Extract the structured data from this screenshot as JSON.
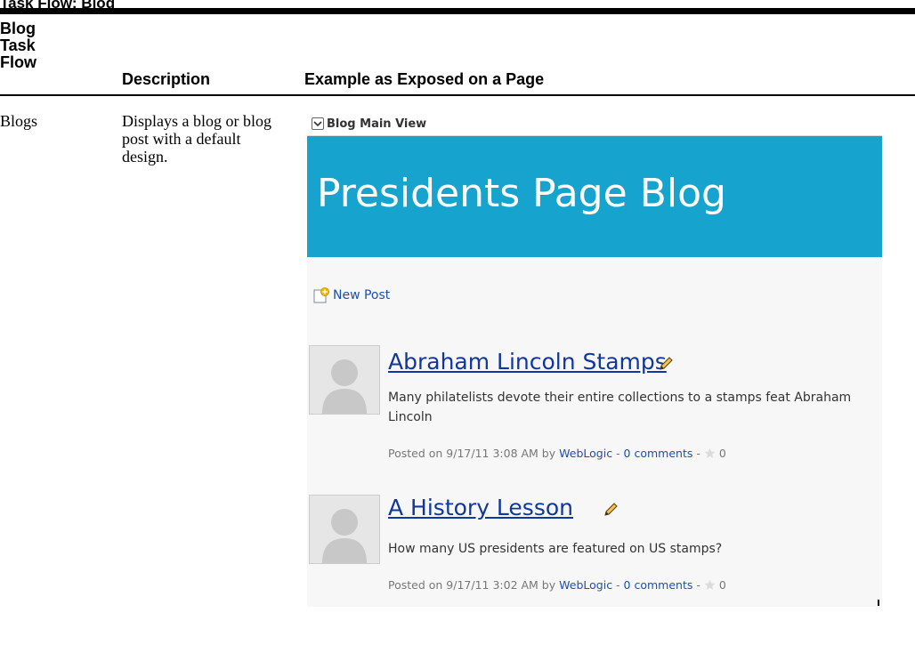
{
  "document": {
    "caption": "Task Flow: Blog",
    "table": {
      "headers": {
        "flow": [
          "Blog",
          "Task",
          "Flow"
        ],
        "description": "Description",
        "example": "Example as Exposed on a Page"
      },
      "row": {
        "flow": "Blogs",
        "description": "Displays a blog or blog post with a default design."
      }
    }
  },
  "example": {
    "panel_title": "Blog Main View",
    "banner_title": "Presidents Page Blog",
    "new_post_label": "New Post",
    "posts": [
      {
        "title": "Abraham Lincoln Stamps",
        "body": "Many philatelists devote their entire collections to a stamps feat Abraham Lincoln",
        "posted": "Posted on 9/17/11 3:08 AM by",
        "author": "WebLogic",
        "comments": "0 comments",
        "rating": "0"
      },
      {
        "title": "A History Lesson",
        "body": "How many US presidents are featured on US stamps?",
        "posted": "Posted on 9/17/11 3:02 AM by",
        "author": "WebLogic",
        "comments": "0 comments",
        "rating": "0"
      }
    ]
  },
  "colors": {
    "banner": "#16a3cd",
    "link": "#1d4fb0",
    "post_title": "#10379e"
  }
}
